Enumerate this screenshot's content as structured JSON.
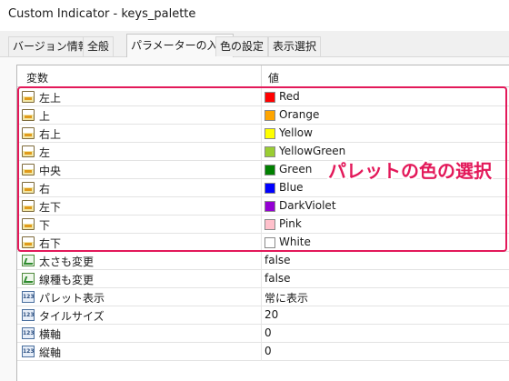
{
  "window": {
    "title": "Custom Indicator - keys_palette"
  },
  "tabs": [
    {
      "label": "バージョン情報"
    },
    {
      "label": "全般"
    },
    {
      "label": "パラメーターの入力",
      "active": true
    },
    {
      "label": "色の設定"
    },
    {
      "label": "表示選択"
    }
  ],
  "table": {
    "headers": {
      "variable": "変数",
      "value": "値"
    },
    "rows": [
      {
        "type": "color",
        "name": "左上",
        "value": "Red",
        "color": "#FF0000"
      },
      {
        "type": "color",
        "name": "上",
        "value": "Orange",
        "color": "#FFA500"
      },
      {
        "type": "color",
        "name": "右上",
        "value": "Yellow",
        "color": "#FFFF00"
      },
      {
        "type": "color",
        "name": "左",
        "value": "YellowGreen",
        "color": "#9ACD32"
      },
      {
        "type": "color",
        "name": "中央",
        "value": "Green",
        "color": "#008000"
      },
      {
        "type": "color",
        "name": "右",
        "value": "Blue",
        "color": "#0000FF"
      },
      {
        "type": "color",
        "name": "左下",
        "value": "DarkViolet",
        "color": "#9400D3"
      },
      {
        "type": "color",
        "name": "下",
        "value": "Pink",
        "color": "#FFC0CB"
      },
      {
        "type": "color",
        "name": "右下",
        "value": "White",
        "color": "#FFFFFF"
      },
      {
        "type": "bool",
        "name": "太さも変更",
        "value": "false"
      },
      {
        "type": "bool",
        "name": "線種も変更",
        "value": "false"
      },
      {
        "type": "number",
        "name": "パレット表示",
        "value": "常に表示"
      },
      {
        "type": "number",
        "name": "タイルサイズ",
        "value": "20"
      },
      {
        "type": "number",
        "name": "横軸",
        "value": "0"
      },
      {
        "type": "number",
        "name": "縦軸",
        "value": "0"
      }
    ]
  },
  "annotation": {
    "text": "パレットの色の選択",
    "color": "#E3195A"
  }
}
